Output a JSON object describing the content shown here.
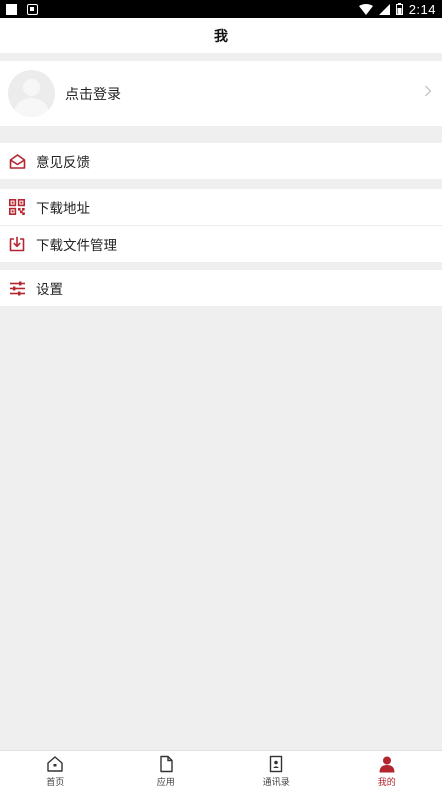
{
  "status_bar": {
    "time": "2:14"
  },
  "header": {
    "title": "我"
  },
  "profile": {
    "login_label": "点击登录"
  },
  "menu": {
    "feedback": "意见反馈",
    "download_address": "下载地址",
    "download_manager": "下载文件管理",
    "settings": "设置"
  },
  "nav": {
    "items": [
      {
        "label": "首页",
        "icon": "home-icon"
      },
      {
        "label": "应用",
        "icon": "document-icon"
      },
      {
        "label": "通讯录",
        "icon": "contacts-icon"
      },
      {
        "label": "我的",
        "icon": "person-icon",
        "active": true
      }
    ]
  },
  "colors": {
    "accent": "#b32630",
    "background": "#efefef"
  }
}
